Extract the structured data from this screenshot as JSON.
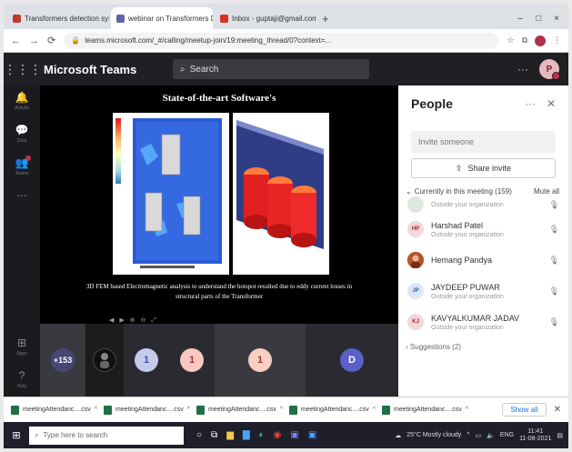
{
  "browser": {
    "tabs": [
      {
        "label": "Transformers detection system ×",
        "favicon_color": "#c0392b"
      },
      {
        "label": "webinar on Transformers Design ×",
        "favicon_color": "#6264a7",
        "active": true
      },
      {
        "label": "Inbox - guptaji@gmail.com ×",
        "favicon_color": "#d93025"
      }
    ],
    "url": "teams.microsoft.com/_#/calling/meetup-join/19:meeting_thread/0?context=...",
    "window_controls": [
      "–",
      "□",
      "×"
    ]
  },
  "teams": {
    "app_title": "Microsoft Teams",
    "search_placeholder": "Search",
    "user_initial": "P",
    "rail": [
      {
        "icon": "activity-icon",
        "label": "Activity",
        "glyph": "🔔"
      },
      {
        "icon": "chat-icon",
        "label": "Chat",
        "glyph": "💬"
      },
      {
        "icon": "teams-icon",
        "label": "Teams",
        "glyph": "👥"
      },
      {
        "icon": "more-icon",
        "label": "",
        "glyph": "⋯"
      }
    ],
    "rail_bottom": [
      {
        "icon": "apps-icon",
        "label": "Apps",
        "glyph": "⊞"
      },
      {
        "icon": "help-icon",
        "label": "Help",
        "glyph": "?"
      }
    ]
  },
  "slide": {
    "title": "State-of-the-art Software's",
    "caption": "3D FEM based Electromagnetic analysis to understand the hotspot resulted due to eddy current losses in structural parts of the Transformer"
  },
  "participants": [
    {
      "label": "+153",
      "bg": "#464775",
      "fg": "#fff",
      "tile_bg": "#3a3940"
    },
    {
      "label": "",
      "bg": "#111111",
      "fg": "#fff",
      "tile_bg": "#1c1c1c"
    },
    {
      "label": "1",
      "bg": "#c5cae9",
      "fg": "#3f51b5",
      "tile_bg": "#2b2a30"
    },
    {
      "label": "1",
      "bg": "#f8c8c2",
      "fg": "#a0392b",
      "tile_bg": "#2b2a30"
    },
    {
      "label": "1",
      "bg": "#f6d0c4",
      "fg": "#a0392b",
      "tile_bg": "#3a3940"
    },
    {
      "label": "D",
      "bg": "#5b5fc7",
      "fg": "#fff",
      "tile_bg": "#2b2a30"
    }
  ],
  "people_panel": {
    "title": "People",
    "invite_placeholder": "Invite someone",
    "share_label": "Share invite",
    "section_label": "Currently in this meeting (159)",
    "mute_all": "Mute all",
    "members": [
      {
        "initials": "",
        "name": "",
        "org": "Outside your organization",
        "av_bg": "#dfe8de",
        "av_fg": "#567"
      },
      {
        "initials": "HP",
        "name": "Harshad Patel",
        "org": "Outside your organization",
        "av_bg": "#f4d6db",
        "av_fg": "#a4262c"
      },
      {
        "initials": "",
        "name": "Hemang Pandya",
        "org": "",
        "av_bg": "#b3542d",
        "av_fg": "#fff"
      },
      {
        "initials": "JP",
        "name": "JAYDEEP PUWAR",
        "org": "Outside your organization",
        "av_bg": "#dbe7f6",
        "av_fg": "#2c5aa0"
      },
      {
        "initials": "KJ",
        "name": "KAVYALKUMAR JADAV",
        "org": "Outside your organization",
        "av_bg": "#f4d6db",
        "av_fg": "#a4262c"
      }
    ],
    "suggestions": "Suggestions (2)"
  },
  "downloads": {
    "items": [
      "meetingAttendanc....csv",
      "meetingAttendanc....csv",
      "meetingAttendanc....csv",
      "meetingAttendanc....csv",
      "meetingAttendanc....csv"
    ],
    "show_all": "Show all"
  },
  "taskbar": {
    "search_placeholder": "Type here to search",
    "weather": "25°C Mostly cloudy",
    "lang": "ENG",
    "time": "11:41",
    "date": "11-08-2021"
  }
}
